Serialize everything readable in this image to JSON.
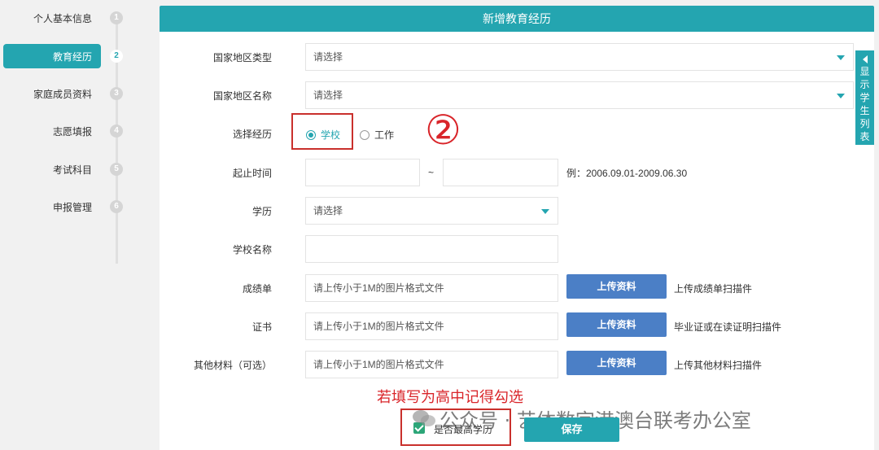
{
  "sidebar": {
    "items": [
      {
        "label": "个人基本信息",
        "num": "1"
      },
      {
        "label": "教育经历",
        "num": "2"
      },
      {
        "label": "家庭成员资料",
        "num": "3"
      },
      {
        "label": "志愿填报",
        "num": "4"
      },
      {
        "label": "考试科目",
        "num": "5"
      },
      {
        "label": "申报管理",
        "num": "6"
      }
    ],
    "active_index": 1
  },
  "panel": {
    "title": "新增教育经历"
  },
  "form": {
    "country_type": {
      "label": "国家地区类型",
      "value": "请选择"
    },
    "country_name": {
      "label": "国家地区名称",
      "value": "请选择"
    },
    "experience": {
      "label": "选择经历",
      "option_school": "学校",
      "option_work": "工作",
      "selected": "学校"
    },
    "period": {
      "label": "起止时间",
      "separator": "~",
      "start_value": "",
      "end_value": "",
      "example": "例：2006.09.01-2009.06.30"
    },
    "degree": {
      "label": "学历",
      "value": "请选择"
    },
    "school_name": {
      "label": "学校名称",
      "value": ""
    },
    "transcript": {
      "label": "成绩单",
      "placeholder": "请上传小于1M的图片格式文件",
      "button": "上传资料",
      "hint": "上传成绩单扫描件"
    },
    "certificate": {
      "label": "证书",
      "placeholder": "请上传小于1M的图片格式文件",
      "button": "上传资料",
      "hint": "毕业证或在读证明扫描件"
    },
    "other": {
      "label": "其他材料（可选）",
      "placeholder": "请上传小于1M的图片格式文件",
      "button": "上传资料",
      "hint": "上传其他材料扫描件"
    },
    "highest_degree": {
      "label": "是否最高学历",
      "checked": true
    },
    "save_label": "保存"
  },
  "side_tab": {
    "text": "显示学生列表"
  },
  "annotations": {
    "circled": "②",
    "note": "若填写为高中记得勾选"
  },
  "watermark": "公众号 · 艺体数字港澳台联考办公室",
  "colors": {
    "accent": "#24a5b0",
    "upload": "#4b7fc6",
    "annotation": "#d9252a"
  }
}
